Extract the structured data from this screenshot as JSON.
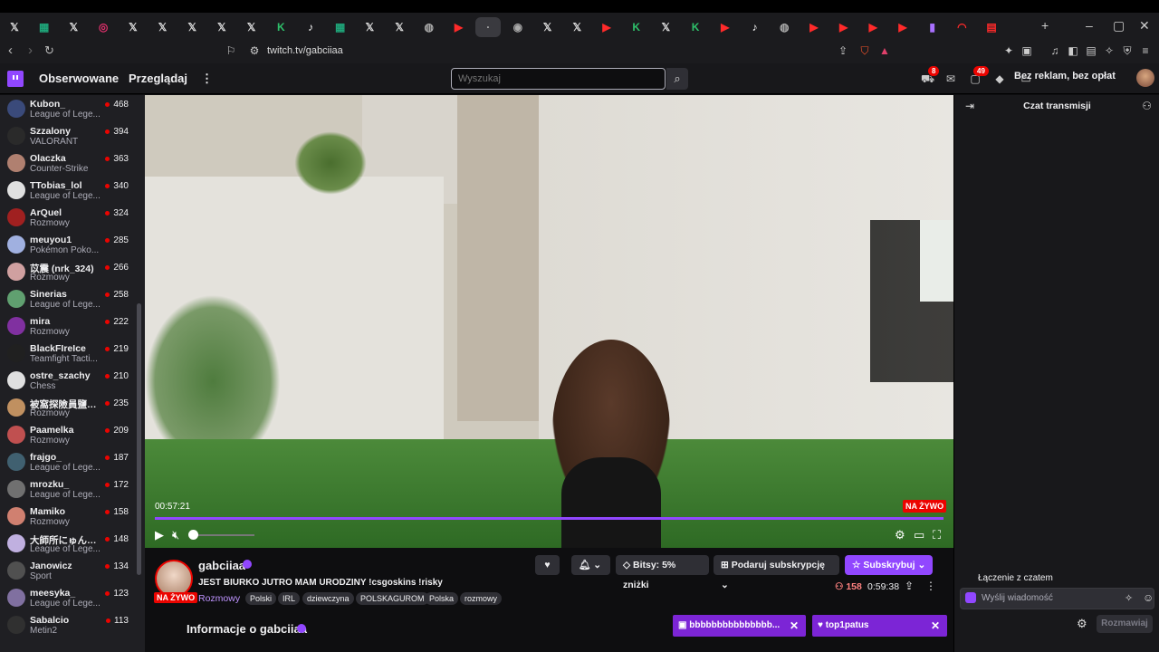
{
  "browser": {
    "tabs": [
      {
        "icon": "x-icon",
        "glyph": "𝕏",
        "cls": "fav-x"
      },
      {
        "icon": "sheets-icon",
        "glyph": "▦",
        "cls": "fav-teal"
      },
      {
        "icon": "x-icon",
        "glyph": "𝕏",
        "cls": "fav-x"
      },
      {
        "icon": "instagram-icon",
        "glyph": "◎",
        "cls": "fav-pink"
      },
      {
        "icon": "x-icon",
        "glyph": "𝕏",
        "cls": "fav-x"
      },
      {
        "icon": "x-icon",
        "glyph": "𝕏",
        "cls": "fav-x"
      },
      {
        "icon": "x-icon",
        "glyph": "𝕏",
        "cls": "fav-x"
      },
      {
        "icon": "x-icon",
        "glyph": "𝕏",
        "cls": "fav-x"
      },
      {
        "icon": "x-icon",
        "glyph": "𝕏",
        "cls": "fav-x"
      },
      {
        "icon": "kick-icon",
        "glyph": "K",
        "cls": "fav-green"
      },
      {
        "icon": "tiktok-icon",
        "glyph": "♪",
        "cls": "fav-tiktok"
      },
      {
        "icon": "sheets-icon",
        "glyph": "▦",
        "cls": "fav-teal"
      },
      {
        "icon": "x-icon",
        "glyph": "𝕏",
        "cls": "fav-x"
      },
      {
        "icon": "x-icon",
        "glyph": "𝕏",
        "cls": "fav-x"
      },
      {
        "icon": "globe-icon",
        "glyph": "◍",
        "cls": "fav-grey"
      },
      {
        "icon": "youtube-icon",
        "glyph": "▶",
        "cls": "fav-red"
      },
      {
        "icon": "twitch-tab-icon",
        "glyph": "·",
        "cls": "fav-grey"
      },
      {
        "icon": "chrome-icon",
        "glyph": "◉",
        "cls": "fav-grey"
      },
      {
        "icon": "x-icon",
        "glyph": "𝕏",
        "cls": "fav-x"
      },
      {
        "icon": "x-icon",
        "glyph": "𝕏",
        "cls": "fav-x"
      },
      {
        "icon": "youtube-icon",
        "glyph": "▶",
        "cls": "fav-red"
      },
      {
        "icon": "kick-icon",
        "glyph": "K",
        "cls": "fav-green"
      },
      {
        "icon": "x-icon",
        "glyph": "𝕏",
        "cls": "fav-x"
      },
      {
        "icon": "kick-icon",
        "glyph": "K",
        "cls": "fav-green"
      },
      {
        "icon": "youtube-icon",
        "glyph": "▶",
        "cls": "fav-red"
      },
      {
        "icon": "tiktok-icon",
        "glyph": "♪",
        "cls": "fav-tiktok"
      },
      {
        "icon": "globe-icon",
        "glyph": "◍",
        "cls": "fav-grey"
      },
      {
        "icon": "youtube-icon",
        "glyph": "▶",
        "cls": "fav-red"
      },
      {
        "icon": "youtube-icon",
        "glyph": "▶",
        "cls": "fav-red"
      },
      {
        "icon": "youtube-icon",
        "glyph": "▶",
        "cls": "fav-red"
      },
      {
        "icon": "youtube-icon",
        "glyph": "▶",
        "cls": "fav-red"
      },
      {
        "icon": "twitch-icon",
        "glyph": "▮",
        "cls": "fav-purple"
      },
      {
        "icon": "loading-icon",
        "glyph": "◠",
        "cls": "fav-red"
      },
      {
        "icon": "chart-icon",
        "glyph": "▤",
        "cls": "fav-red"
      }
    ],
    "new_tab": "+",
    "url": "twitch.tv/gabciiaa"
  },
  "nav": {
    "following": "Obserwowane",
    "browse": "Przeglądaj",
    "search_placeholder": "Wyszukaj",
    "notif_count_1": "8",
    "notif_count_2": "49",
    "no_ads": "Bez reklam, bez opłat"
  },
  "sidebar": {
    "channels": [
      {
        "name": "Kubon_",
        "game": "League of Lege...",
        "viewers": "468",
        "color": "#3a4a7a"
      },
      {
        "name": "Szzalony",
        "game": "VALORANT",
        "viewers": "394",
        "color": "#2a2a2a"
      },
      {
        "name": "Olaczka",
        "game": "Counter-Strike",
        "viewers": "363",
        "color": "#b08070"
      },
      {
        "name": "TTobias_lol",
        "game": "League of Lege...",
        "viewers": "340",
        "color": "#e0e0e0"
      },
      {
        "name": "ArQuel",
        "game": "Rozmowy",
        "viewers": "324",
        "color": "#a02020"
      },
      {
        "name": "meuyou1",
        "game": "Pokémon Poko...",
        "viewers": "285",
        "color": "#a0b0e0"
      },
      {
        "name": "苡震 (nrk_324)",
        "game": "Rozmowy",
        "viewers": "266",
        "color": "#d0a0a0"
      },
      {
        "name": "Sinerias",
        "game": "League of Lege...",
        "viewers": "258",
        "color": "#60a070"
      },
      {
        "name": "mira",
        "game": "Rozmowy",
        "viewers": "222",
        "color": "#8030a0"
      },
      {
        "name": "BlackFIreIce",
        "game": "Teamfight Tacti...",
        "viewers": "219",
        "color": "#202020"
      },
      {
        "name": "ostre_szachy",
        "game": "Chess",
        "viewers": "210",
        "color": "#e0e0e0"
      },
      {
        "name": "被窩探險員鹽拉 (...",
        "game": "Rozmowy",
        "viewers": "235",
        "color": "#c09060"
      },
      {
        "name": "Paamelka",
        "game": "Rozmowy",
        "viewers": "209",
        "color": "#c05050"
      },
      {
        "name": "frajgo_",
        "game": "League of Lege...",
        "viewers": "187",
        "color": "#406070"
      },
      {
        "name": "mrozku_",
        "game": "League of Lege...",
        "viewers": "172",
        "color": "#707070"
      },
      {
        "name": "Mamiko",
        "game": "Rozmowy",
        "viewers": "158",
        "color": "#d08070"
      },
      {
        "name": "大師所にゅん子 (...",
        "game": "League of Lege...",
        "viewers": "148",
        "color": "#c0b0e0"
      },
      {
        "name": "Janowicz",
        "game": "Sport",
        "viewers": "134",
        "color": "#505050"
      },
      {
        "name": "meesyka_",
        "game": "League of Lege...",
        "viewers": "123",
        "color": "#8070a0"
      },
      {
        "name": "Sabalcio",
        "game": "Metin2",
        "viewers": "113",
        "color": "#303030"
      }
    ]
  },
  "player": {
    "time": "00:57:21",
    "live_label": "NA ŻYWO",
    "progress": 1.0,
    "volume": 0.0
  },
  "channel": {
    "name": "gabciiaa",
    "title": "JEST BIURKO JUTRO MAM URODZINY !csgoskins !risky",
    "category": "Rozmowy",
    "tags": [
      "Polski",
      "IRL",
      "dziewczyna",
      "POLSKAGUROM",
      "Polska",
      "rozmowy"
    ],
    "live_label": "NA ŻYWO",
    "bits_label": "Bitsy: 5% zniżki",
    "gift_label": "Podaruj subskrypcję",
    "subscribe_label": "Subskrybuj",
    "viewers": "158",
    "uptime": "0:59:38",
    "about": "Informacje o gabciiaa"
  },
  "chat": {
    "title": "Czat transmisji",
    "connecting": "Łączenie z czatem",
    "input_placeholder": "Wyślij wiadomość",
    "send_label": "Rozmawiaj"
  },
  "notifications": [
    {
      "text": "bbbbbbbbbbbbbbb..."
    },
    {
      "text": "top1patus"
    }
  ]
}
